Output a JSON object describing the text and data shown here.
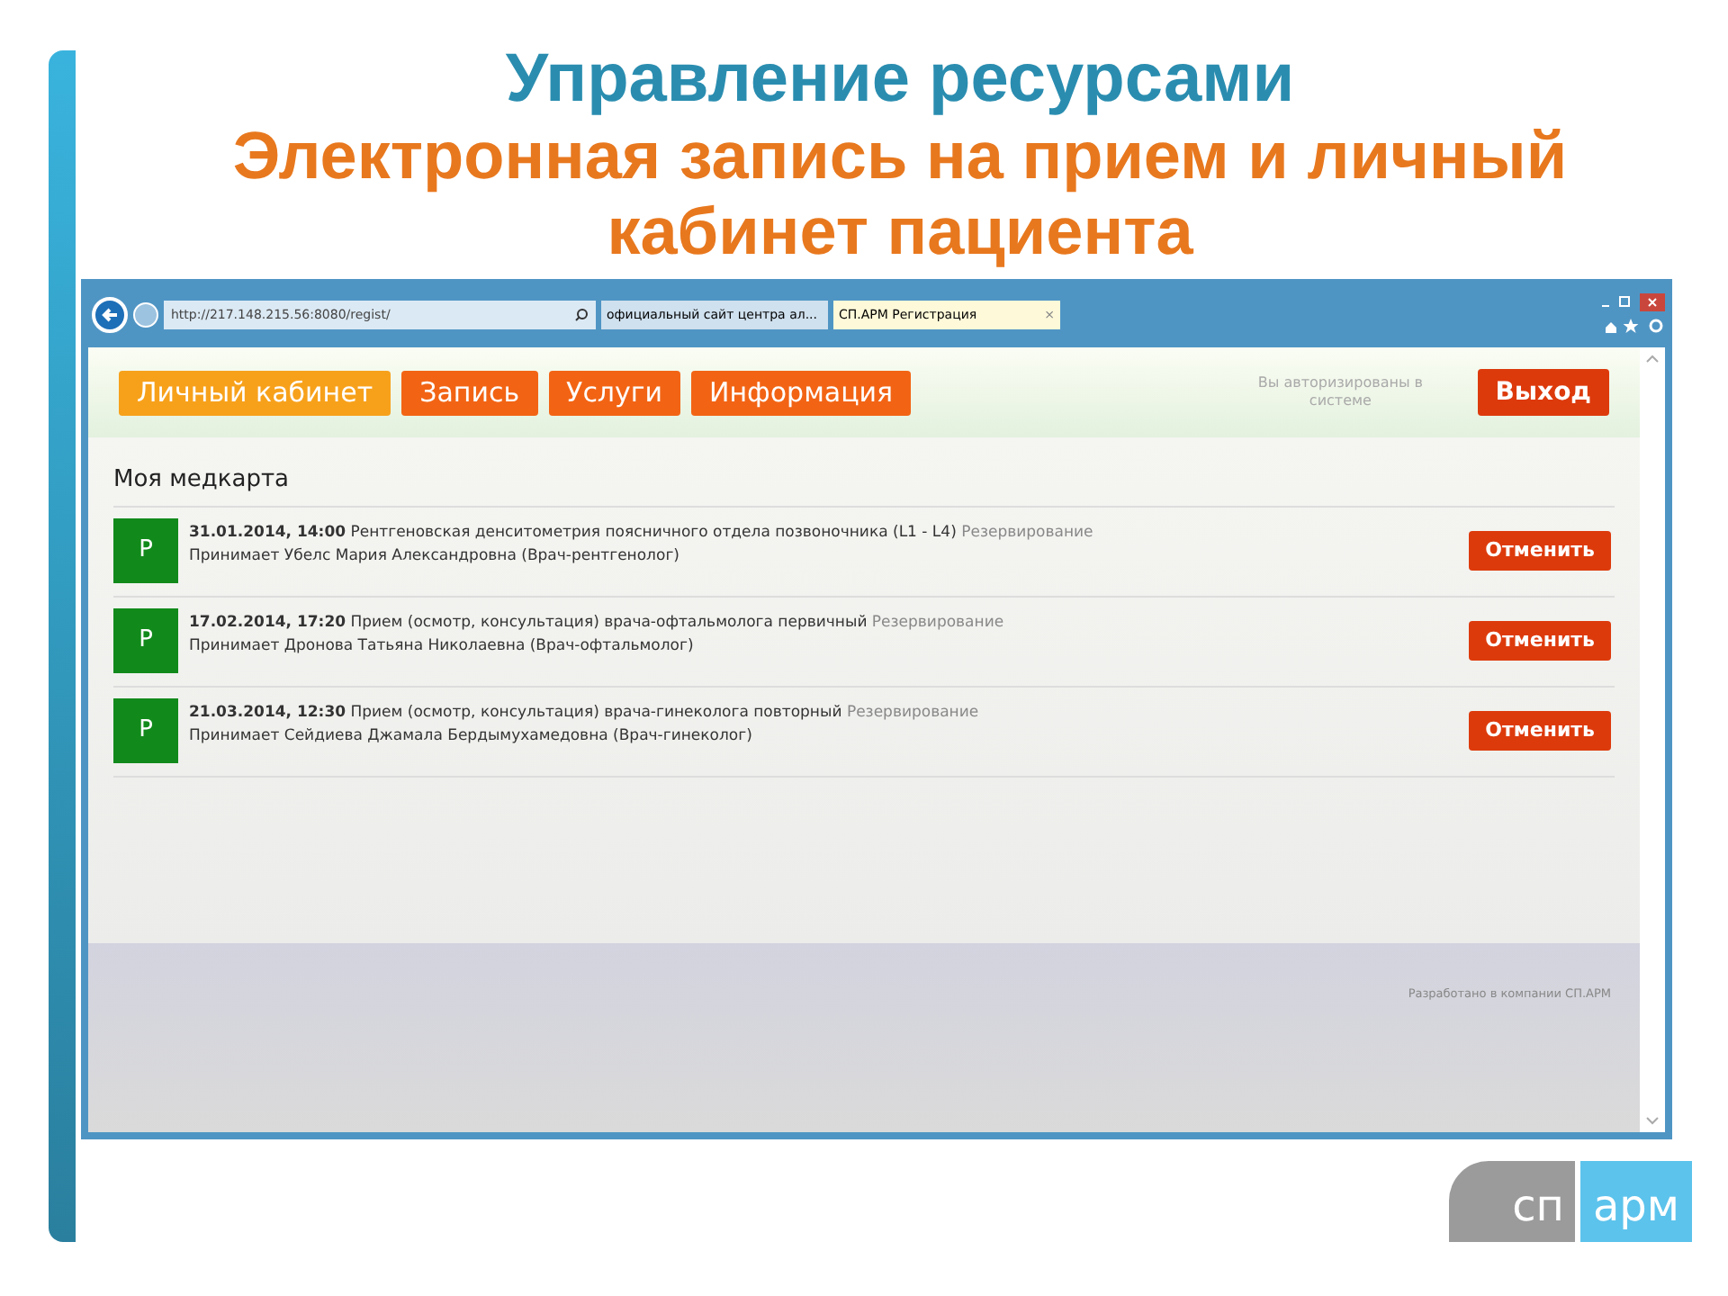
{
  "slide": {
    "title": "Управление ресурсами",
    "subtitle": "Электронная запись на прием и личный кабинет пациента"
  },
  "browser": {
    "url": "http://217.148.215.56:8080/regist/",
    "tabs": [
      {
        "label": "официальный сайт центра ал...",
        "selected": false
      },
      {
        "label": "СП.АРМ Регистрация",
        "selected": true,
        "close": "×"
      }
    ]
  },
  "nav": [
    {
      "label": "Личный кабинет",
      "selected": true
    },
    {
      "label": "Запись",
      "selected": false
    },
    {
      "label": "Услуги",
      "selected": false
    },
    {
      "label": "Информация",
      "selected": false
    }
  ],
  "auth_note": "Вы авторизированы в системе",
  "logout": "Выход",
  "section_title": "Моя медкарта",
  "appointments": [
    {
      "badge": "Р",
      "datetime": "31.01.2014, 14:00",
      "service": "Рентгеновская денситометрия поясничного отдела позвоночника (L1 - L4)",
      "status": "Резервирование",
      "doctor": "Принимает Убелс Мария Александровна (Врач-рентгенолог)",
      "action": "Отменить"
    },
    {
      "badge": "Р",
      "datetime": "17.02.2014, 17:20",
      "service": "Прием (осмотр, консультация) врача-офтальмолога первичный",
      "status": "Резервирование",
      "doctor": "Принимает Дронова Татьяна Николаевна (Врач-офтальмолог)",
      "action": "Отменить"
    },
    {
      "badge": "Р",
      "datetime": "21.03.2014, 12:30",
      "service": "Прием (осмотр, консультация) врача-гинеколога повторный",
      "status": "Резервирование",
      "doctor": "Принимает Сейдиева Джамала Бердымухамедовна (Врач-гинеколог)",
      "action": "Отменить"
    }
  ],
  "footer": "Разработано в компании СП.АРМ",
  "logo": {
    "left": "сп",
    "right": "арм"
  }
}
